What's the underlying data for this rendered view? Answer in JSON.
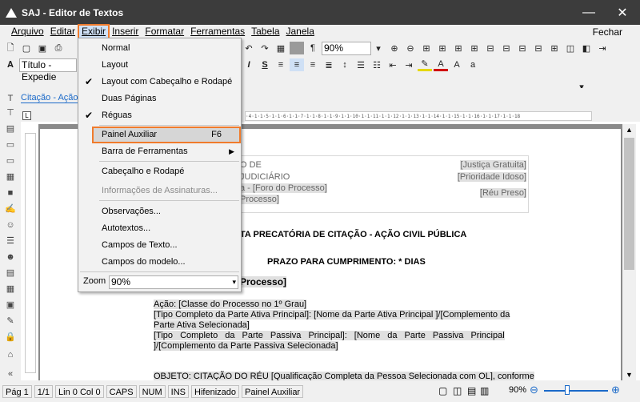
{
  "window": {
    "title": "SAJ - Editor de Textos",
    "min": "—",
    "close": "✕"
  },
  "menubar": {
    "items": [
      "Arquivo",
      "Editar",
      "Exibir",
      "Inserir",
      "Formatar",
      "Ferramentas",
      "Tabela",
      "Janela"
    ],
    "close_doc": "Fechar"
  },
  "toolbar": {
    "zoom_value": "90%",
    "style_value": "Título - Expedie",
    "paragraph_mark": "¶"
  },
  "tab": {
    "label": "Citação - Ação"
  },
  "exibir_menu": {
    "items": [
      {
        "label": "Normal",
        "checked": false
      },
      {
        "label": "Layout",
        "checked": false
      },
      {
        "label": "Layout com Cabeçalho e Rodapé",
        "checked": true
      },
      {
        "label": "Duas Páginas",
        "checked": false
      },
      {
        "label": "Réguas",
        "checked": true
      },
      {
        "label": "Painel Auxiliar",
        "shortcut": "F6"
      },
      {
        "label": "Barra de Ferramentas",
        "submenu": true
      },
      {
        "label": "Cabeçalho e Rodapé"
      },
      {
        "label": "Informações de Assinaturas...",
        "disabled": true
      },
      {
        "label": "Observações..."
      },
      {
        "label": "Autotextos..."
      },
      {
        "label": "Campos de Texto..."
      },
      {
        "label": "Campos do modelo..."
      }
    ],
    "zoom_label": "Zoom",
    "zoom_value": "90%"
  },
  "document": {
    "header_left": [
      "O DE",
      "JUDICIÁRIO",
      "a - [Foro do Processo]",
      "Processo]"
    ],
    "header_right": [
      "[Justiça Gratuita]",
      "[Prioridade Idoso]",
      "[Réu Preso]"
    ],
    "title": "TA PRECATÓRIA DE CITAÇÃO - AÇÃO CIVIL PÚBLICA",
    "deadline": "PRAZO PARA CUMPRIMENTO: * DIAS",
    "process": "Processo]",
    "lines": [
      "Ação: [Classe do Processo no 1º Grau]",
      "[Tipo Completo da Parte Ativa Principal]: [Nome da Parte Ativa Principal ]/[Complemento da",
      "Parte Ativa Selecionada]",
      "[Tipo Completo da Parte Passiva Principal]: [Nome da Parte Passiva Principal",
      "]/[Complemento da Parte Passiva Selecionada]"
    ],
    "object_line": "OBJETO: CITAÇÃO DO RÉU [Qualificação Completa da Pessoa Selecionada com OL], conforme"
  },
  "status": {
    "page": "Pág 1",
    "pages": "1/1",
    "pos": "Lin 0 Col 0",
    "caps": "CAPS",
    "num": "NUM",
    "ins": "INS",
    "hyph": "Hifenizado",
    "panel": "Painel Auxiliar",
    "zoom": "90%"
  }
}
